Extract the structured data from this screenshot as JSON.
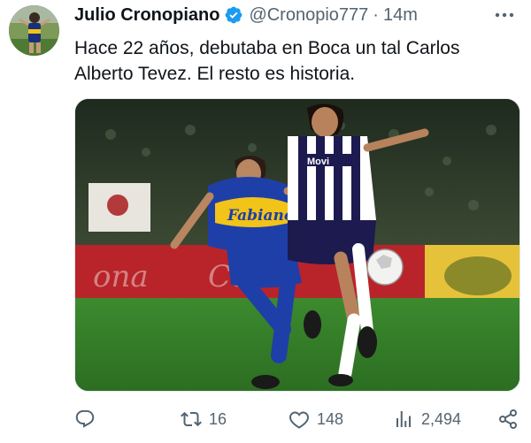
{
  "author": {
    "display_name": "Julio Cronopiano",
    "handle": "@Cronopio777",
    "separator": "·",
    "time": "14m",
    "verified": true
  },
  "tweet": {
    "text_line1": "Hace 22 años, debutaba en Boca un tal Carlos",
    "text_line2": "Alberto Tevez. El resto es historia."
  },
  "photo": {
    "jersey_text": "Fabiano",
    "opponent_jersey_text": "Movi",
    "board_text": "Coca-Cola"
  },
  "actions": {
    "reply": {
      "icon": "reply-icon",
      "count": ""
    },
    "retweet": {
      "icon": "retweet-icon",
      "count": "16"
    },
    "like": {
      "icon": "heart-icon",
      "count": "148"
    },
    "views": {
      "icon": "views-icon",
      "count": "2,494"
    },
    "share": {
      "icon": "share-icon"
    }
  },
  "colors": {
    "verified": "#1d9bf0",
    "muted": "#536471",
    "boca_blue": "#1e3fa8",
    "boca_gold": "#f2c318"
  }
}
